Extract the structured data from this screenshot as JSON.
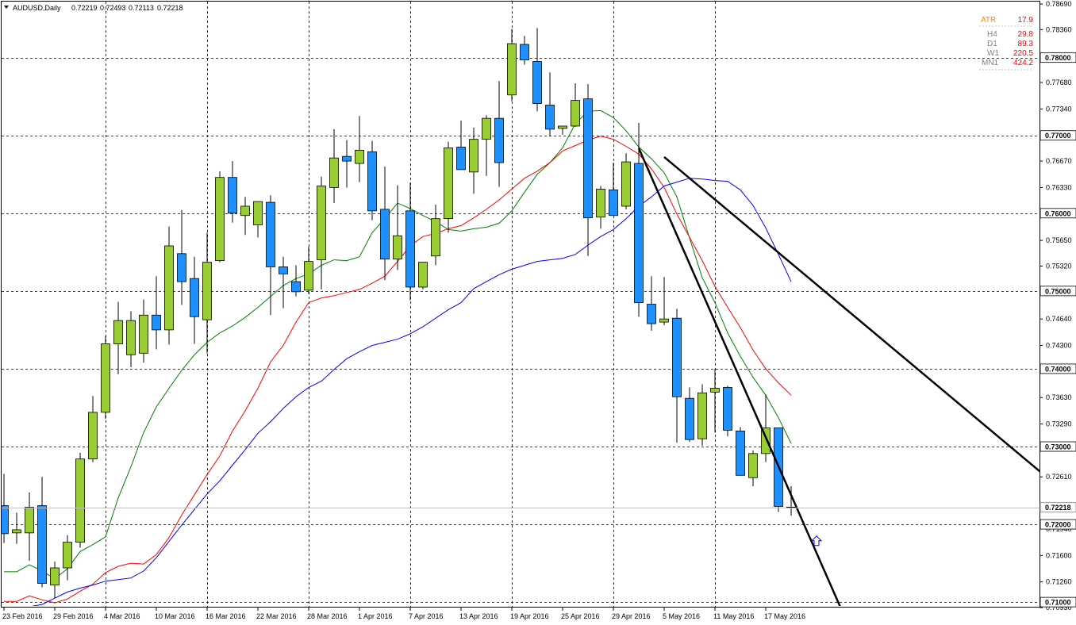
{
  "header": {
    "symbol": "AUDUSD,Daily",
    "open": "0.72219",
    "high": "0.72493",
    "low": "0.72113",
    "close": "0.72218"
  },
  "atr_panel": {
    "title_label": "ATR",
    "title_value": "17.9",
    "rows": [
      {
        "label": "H4",
        "value": "29.8"
      },
      {
        "label": "D1",
        "value": "89.3"
      },
      {
        "label": "W1",
        "value": "220.5"
      },
      {
        "label": "MN1",
        "value": "424.2"
      }
    ]
  },
  "colors": {
    "bull": "#9acd32",
    "bear": "#1e90ff",
    "ma_fast": "#008000",
    "ma_mid": "#ff0000",
    "ma_slow": "#0000ff",
    "atr_title": "#ff8c00",
    "atr_value": "#ff0000",
    "atr_label": "#808080",
    "trendline": "#000000",
    "arrow": "#0000ff"
  },
  "price_axis": {
    "ticks": [
      "0.78690",
      "0.78360",
      "0.77680",
      "0.77340",
      "0.76670",
      "0.76330",
      "0.75650",
      "0.75320",
      "0.74640",
      "0.74300",
      "0.73630",
      "0.73290",
      "0.72610",
      "0.71940",
      "0.71600",
      "0.71260",
      "0.70930"
    ],
    "ticks_values": [
      0.7869,
      0.7836,
      0.7768,
      0.7734,
      0.7667,
      0.7633,
      0.7565,
      0.7532,
      0.7464,
      0.743,
      0.7363,
      0.7329,
      0.7261,
      0.7194,
      0.716,
      0.7126,
      0.7093
    ],
    "boxed": [
      "0.78000",
      "0.77000",
      "0.76000",
      "0.75000",
      "0.74000",
      "0.73000",
      "0.72000",
      "0.71000"
    ],
    "boxed_values": [
      0.78,
      0.77,
      0.76,
      0.75,
      0.74,
      0.73,
      0.72,
      0.71
    ],
    "current_label": "0.72218",
    "current_value": 0.72218
  },
  "time_axis": {
    "labels": [
      "23 Feb 2016",
      "29 Feb 2016",
      "4 Mar 2016",
      "10 Mar 2016",
      "16 Mar 2016",
      "22 Mar 2016",
      "28 Mar 2016",
      "1 Apr 2016",
      "7 Apr 2016",
      "13 Apr 2016",
      "19 Apr 2016",
      "25 Apr 2016",
      "29 Apr 2016",
      "5 May 2016",
      "11 May 2016",
      "17 May 2016"
    ],
    "label_bar_index": [
      0,
      4,
      8,
      12,
      16,
      20,
      24,
      28,
      32,
      36,
      40,
      44,
      48,
      52,
      56,
      60
    ]
  },
  "chart_data": {
    "type": "candlestick",
    "symbol": "AUDUSD",
    "timeframe": "Daily",
    "ylim": [
      0.7093,
      0.7869
    ],
    "grid": true,
    "bar_dates": [
      "23 Feb 2016",
      "24 Feb 2016",
      "25 Feb 2016",
      "26 Feb 2016",
      "29 Feb 2016",
      "1 Mar 2016",
      "2 Mar 2016",
      "3 Mar 2016",
      "4 Mar 2016",
      "7 Mar 2016",
      "8 Mar 2016",
      "9 Mar 2016",
      "10 Mar 2016",
      "11 Mar 2016",
      "14 Mar 2016",
      "15 Mar 2016",
      "16 Mar 2016",
      "17 Mar 2016",
      "18 Mar 2016",
      "21 Mar 2016",
      "22 Mar 2016",
      "23 Mar 2016",
      "24 Mar 2016",
      "25 Mar 2016",
      "28 Mar 2016",
      "29 Mar 2016",
      "30 Mar 2016",
      "31 Mar 2016",
      "1 Apr 2016",
      "4 Apr 2016",
      "5 Apr 2016",
      "6 Apr 2016",
      "7 Apr 2016",
      "8 Apr 2016",
      "11 Apr 2016",
      "12 Apr 2016",
      "13 Apr 2016",
      "14 Apr 2016",
      "15 Apr 2016",
      "18 Apr 2016",
      "19 Apr 2016",
      "20 Apr 2016",
      "21 Apr 2016",
      "22 Apr 2016",
      "25 Apr 2016",
      "26 Apr 2016",
      "27 Apr 2016",
      "28 Apr 2016",
      "29 Apr 2016",
      "2 May 2016",
      "3 May 2016",
      "4 May 2016",
      "5 May 2016",
      "6 May 2016",
      "9 May 2016",
      "10 May 2016",
      "11 May 2016",
      "12 May 2016",
      "13 May 2016",
      "16 May 2016",
      "17 May 2016",
      "18 May 2016",
      "19 May 2016"
    ],
    "candles": [
      [
        0.7224,
        0.7265,
        0.7176,
        0.7188
      ],
      [
        0.7189,
        0.7215,
        0.7175,
        0.7193
      ],
      [
        0.7189,
        0.7241,
        0.7153,
        0.7222
      ],
      [
        0.7224,
        0.7261,
        0.7119,
        0.7124
      ],
      [
        0.7122,
        0.7152,
        0.7105,
        0.7144
      ],
      [
        0.7144,
        0.7186,
        0.7128,
        0.7177
      ],
      [
        0.7177,
        0.7292,
        0.717,
        0.7284
      ],
      [
        0.7284,
        0.7365,
        0.728,
        0.7344
      ],
      [
        0.7344,
        0.7442,
        0.7336,
        0.7432
      ],
      [
        0.7432,
        0.7486,
        0.7393,
        0.7462
      ],
      [
        0.7418,
        0.7474,
        0.7402,
        0.7462
      ],
      [
        0.742,
        0.7489,
        0.7408,
        0.7469
      ],
      [
        0.7469,
        0.7519,
        0.7425,
        0.745
      ],
      [
        0.745,
        0.7583,
        0.7431,
        0.7558
      ],
      [
        0.7548,
        0.7604,
        0.7482,
        0.7512
      ],
      [
        0.7516,
        0.7544,
        0.7432,
        0.7467
      ],
      [
        0.7463,
        0.7575,
        0.742,
        0.7537
      ],
      [
        0.7539,
        0.7654,
        0.7537,
        0.7646
      ],
      [
        0.7646,
        0.7667,
        0.7588,
        0.76
      ],
      [
        0.7597,
        0.7621,
        0.7572,
        0.7609
      ],
      [
        0.7585,
        0.7613,
        0.7569,
        0.7615
      ],
      [
        0.7614,
        0.7623,
        0.7469,
        0.7531
      ],
      [
        0.7531,
        0.7544,
        0.7478,
        0.7522
      ],
      [
        0.7512,
        0.7533,
        0.7493,
        0.7499
      ],
      [
        0.7501,
        0.7557,
        0.7496,
        0.7538
      ],
      [
        0.754,
        0.7647,
        0.7502,
        0.7635
      ],
      [
        0.7633,
        0.7708,
        0.7613,
        0.7671
      ],
      [
        0.7673,
        0.7694,
        0.7633,
        0.7667
      ],
      [
        0.7664,
        0.7725,
        0.764,
        0.7681
      ],
      [
        0.7679,
        0.7693,
        0.7591,
        0.7603
      ],
      [
        0.7605,
        0.766,
        0.7514,
        0.7541
      ],
      [
        0.7541,
        0.7636,
        0.7527,
        0.7571
      ],
      [
        0.7603,
        0.7639,
        0.7488,
        0.7505
      ],
      [
        0.7505,
        0.7537,
        0.7502,
        0.7537
      ],
      [
        0.7545,
        0.7611,
        0.7533,
        0.7593
      ],
      [
        0.7593,
        0.7692,
        0.7575,
        0.7684
      ],
      [
        0.7685,
        0.7719,
        0.7657,
        0.7656
      ],
      [
        0.7653,
        0.771,
        0.7625,
        0.7695
      ],
      [
        0.7695,
        0.7726,
        0.7648,
        0.7722
      ],
      [
        0.7722,
        0.777,
        0.7634,
        0.7665
      ],
      [
        0.7752,
        0.7837,
        0.7744,
        0.7818
      ],
      [
        0.7817,
        0.7828,
        0.7791,
        0.7797
      ],
      [
        0.7795,
        0.7838,
        0.7731,
        0.7741
      ],
      [
        0.7739,
        0.7781,
        0.7699,
        0.7708
      ],
      [
        0.7709,
        0.7712,
        0.7701,
        0.7712
      ],
      [
        0.7712,
        0.7767,
        0.7711,
        0.7745
      ],
      [
        0.7747,
        0.7766,
        0.7545,
        0.7594
      ],
      [
        0.7595,
        0.7635,
        0.758,
        0.7631
      ],
      [
        0.763,
        0.7665,
        0.7597,
        0.7597
      ],
      [
        0.7609,
        0.7677,
        0.7605,
        0.7666
      ],
      [
        0.7664,
        0.7716,
        0.7467,
        0.7485
      ],
      [
        0.7483,
        0.7519,
        0.7449,
        0.7458
      ],
      [
        0.746,
        0.7518,
        0.7456,
        0.7464
      ],
      [
        0.7465,
        0.7477,
        0.7305,
        0.7364
      ],
      [
        0.7362,
        0.7376,
        0.7306,
        0.7309
      ],
      [
        0.731,
        0.738,
        0.7301,
        0.7369
      ],
      [
        0.737,
        0.74,
        0.7318,
        0.7375
      ],
      [
        0.7376,
        0.7378,
        0.7313,
        0.7321
      ],
      [
        0.732,
        0.7325,
        0.7263,
        0.7263
      ],
      [
        0.726,
        0.7295,
        0.7249,
        0.7291
      ],
      [
        0.7291,
        0.7367,
        0.728,
        0.7324
      ],
      [
        0.7324,
        0.7324,
        0.7216,
        0.7223
      ],
      [
        0.7222,
        0.7249,
        0.7211,
        0.7222
      ]
    ],
    "moving_averages": [
      {
        "values": [
          0.7139,
          0.7139,
          0.7148,
          0.714,
          0.713,
          0.7143,
          0.7165,
          0.7174,
          0.7184,
          0.7234,
          0.7274,
          0.7318,
          0.7351,
          0.7375,
          0.7398,
          0.7418,
          0.7434,
          0.7446,
          0.7455,
          0.7466,
          0.7479,
          0.7493,
          0.7507,
          0.7516,
          0.7522,
          0.7533,
          0.754,
          0.7539,
          0.7544,
          0.7575,
          0.7593,
          0.7613,
          0.7606,
          0.7597,
          0.7589,
          0.7579,
          0.7577,
          0.758,
          0.7582,
          0.7587,
          0.7603,
          0.7627,
          0.765,
          0.7665,
          0.7684,
          0.7715,
          0.7731,
          0.7732,
          0.7723,
          0.7706,
          0.7685,
          0.767,
          0.7652,
          0.7621,
          0.7568,
          0.7517,
          0.7485,
          0.7446,
          0.7416,
          0.7389,
          0.7366,
          0.7337,
          0.7304
        ]
      },
      {
        "values": [
          0.7101,
          0.7101,
          0.7108,
          0.7103,
          0.7099,
          0.7104,
          0.7114,
          0.7123,
          0.7138,
          0.7146,
          0.715,
          0.7149,
          0.7161,
          0.7183,
          0.7212,
          0.7238,
          0.7264,
          0.7288,
          0.732,
          0.7346,
          0.7375,
          0.7409,
          0.743,
          0.746,
          0.7485,
          0.7491,
          0.7494,
          0.7498,
          0.7502,
          0.751,
          0.7519,
          0.7538,
          0.7558,
          0.757,
          0.7574,
          0.758,
          0.7584,
          0.7594,
          0.7605,
          0.7617,
          0.7631,
          0.7645,
          0.7654,
          0.7665,
          0.768,
          0.7687,
          0.7694,
          0.7699,
          0.7695,
          0.7686,
          0.7676,
          0.7657,
          0.7633,
          0.7599,
          0.7569,
          0.7539,
          0.7506,
          0.7479,
          0.7453,
          0.7424,
          0.74,
          0.7382,
          0.7366
        ]
      },
      {
        "values": [
          0.7093,
          0.7093,
          0.7094,
          0.7097,
          0.7105,
          0.7113,
          0.7118,
          0.7122,
          0.7127,
          0.7129,
          0.7131,
          0.714,
          0.7157,
          0.7178,
          0.7199,
          0.7219,
          0.7239,
          0.7256,
          0.7276,
          0.7296,
          0.7317,
          0.7332,
          0.7349,
          0.7364,
          0.7376,
          0.7384,
          0.7399,
          0.7413,
          0.7422,
          0.743,
          0.7434,
          0.7438,
          0.7445,
          0.7454,
          0.7465,
          0.7476,
          0.7485,
          0.7503,
          0.7512,
          0.7521,
          0.7528,
          0.7533,
          0.7538,
          0.754,
          0.7542,
          0.7547,
          0.7559,
          0.757,
          0.7579,
          0.7593,
          0.7609,
          0.7621,
          0.7635,
          0.764,
          0.7645,
          0.7644,
          0.7642,
          0.7641,
          0.763,
          0.761,
          0.7581,
          0.7547,
          0.7512
        ]
      }
    ],
    "trendlines": [
      {
        "from": {
          "bar": 50,
          "price": 0.76835
        },
        "to": {
          "bar": 66,
          "price": 0.7089
        }
      },
      {
        "from": {
          "bar": 52,
          "price": 0.76723
        },
        "to": {
          "bar": 82,
          "price": 0.72624
        }
      }
    ],
    "arrow": {
      "bar": 64,
      "price": 0.7185
    }
  }
}
